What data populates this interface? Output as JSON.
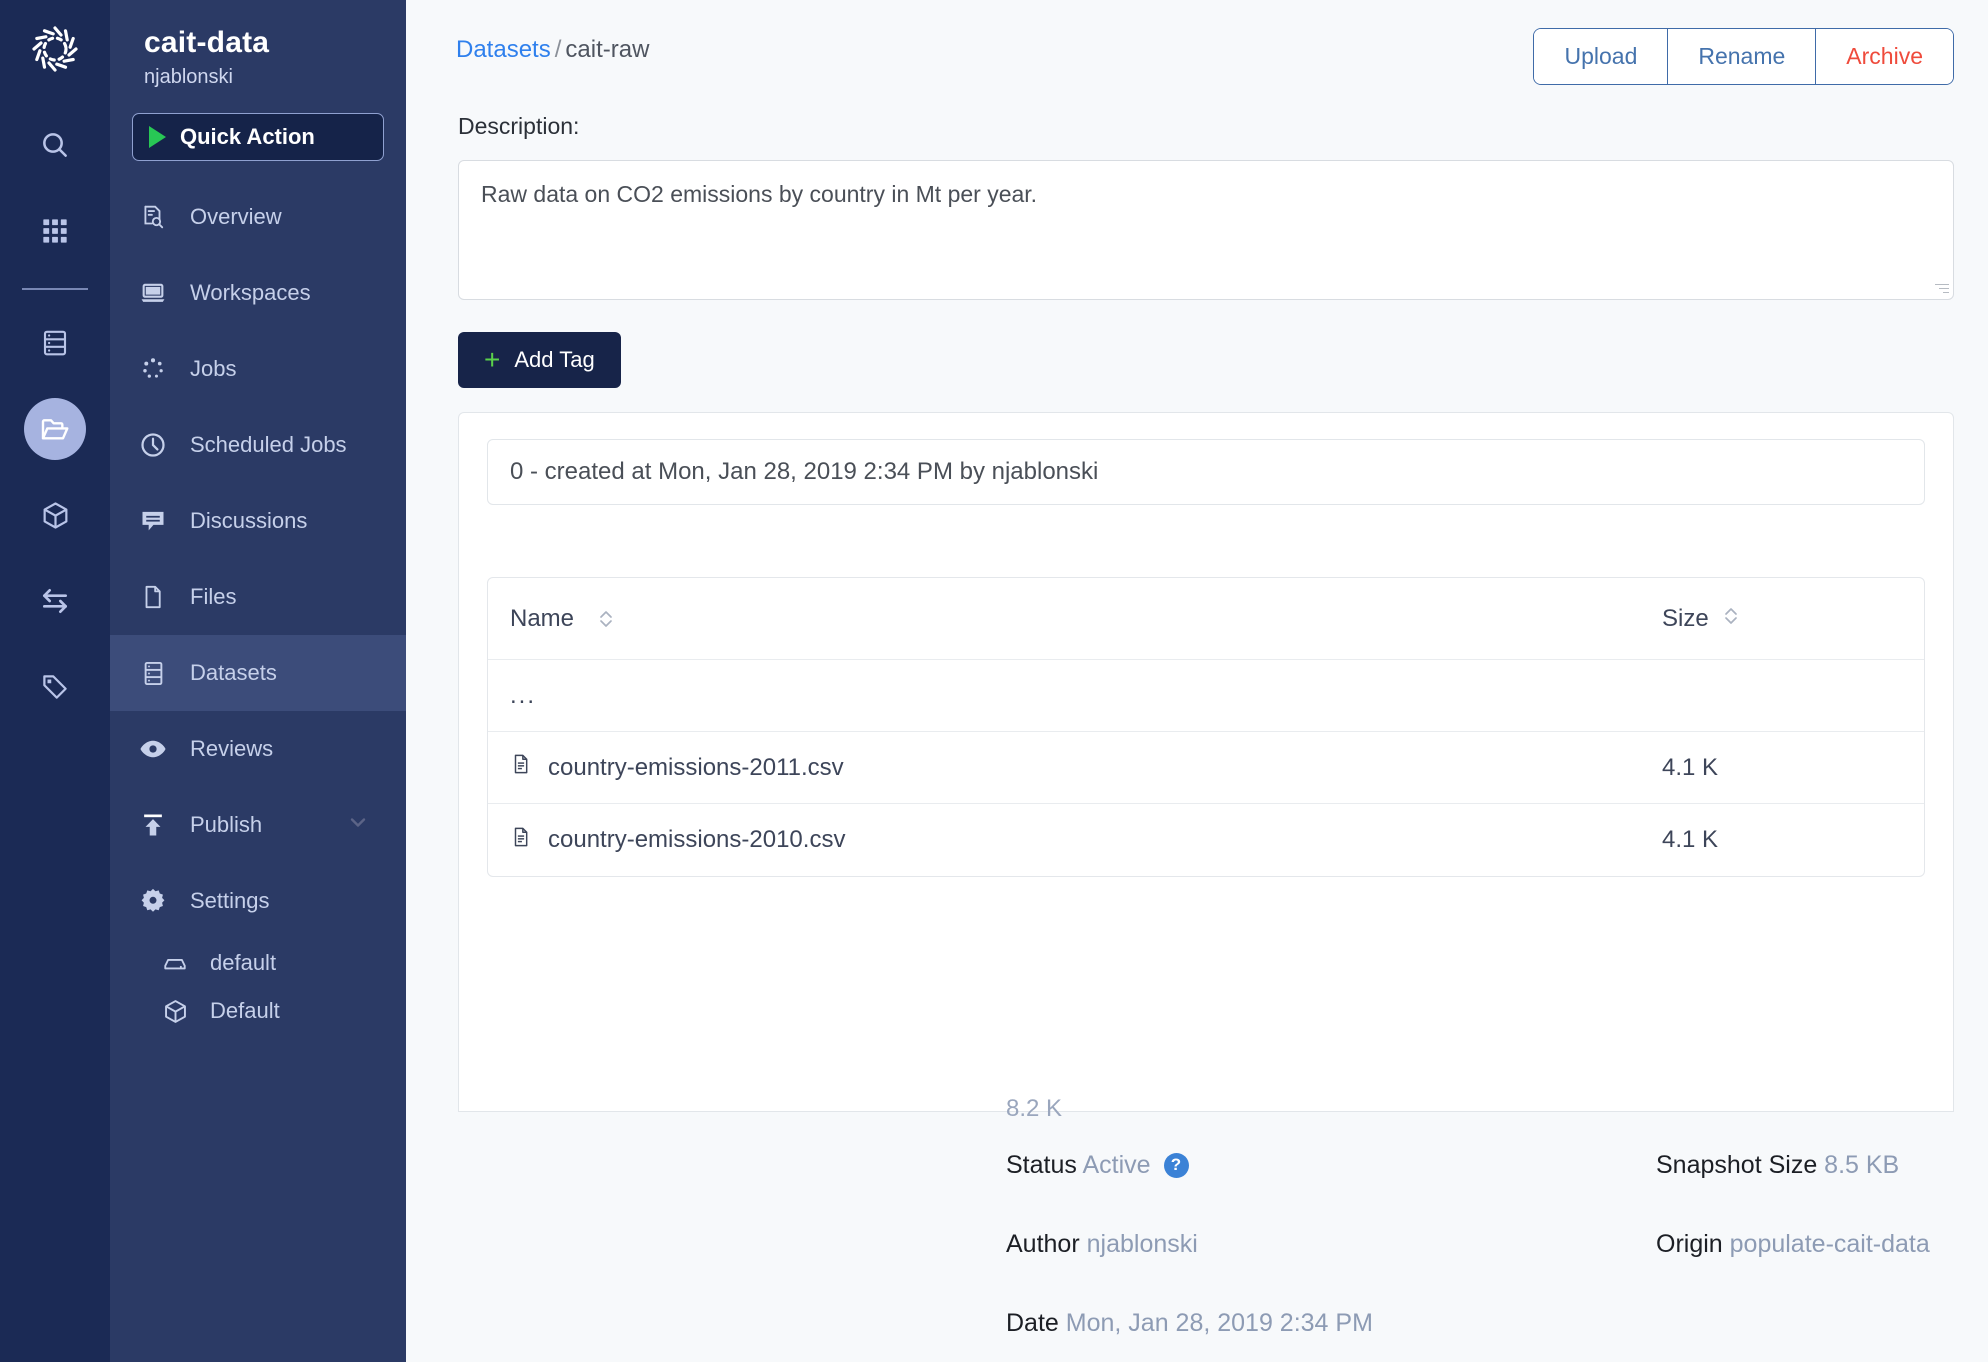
{
  "rail": {
    "logo": "aperture-logo-icon",
    "items": [
      {
        "name": "search-icon",
        "active": false
      },
      {
        "name": "apps-grid-icon",
        "active": false
      },
      {
        "name": "database-icon",
        "active": false
      },
      {
        "name": "folder-open-icon",
        "active": true
      },
      {
        "name": "cube-icon",
        "active": false
      },
      {
        "name": "transfer-arrows-icon",
        "active": false
      },
      {
        "name": "tag-icon",
        "active": false
      }
    ]
  },
  "sidebar": {
    "project_title": "cait-data",
    "owner": "njablonski",
    "quick_action_label": "Quick Action",
    "items": [
      {
        "label": "Overview",
        "icon": "overview-icon",
        "selected": false
      },
      {
        "label": "Workspaces",
        "icon": "laptop-icon",
        "selected": false
      },
      {
        "label": "Jobs",
        "icon": "spinner-icon",
        "selected": false
      },
      {
        "label": "Scheduled Jobs",
        "icon": "clock-icon",
        "selected": false
      },
      {
        "label": "Discussions",
        "icon": "chat-icon",
        "selected": false
      },
      {
        "label": "Files",
        "icon": "file-icon",
        "selected": false
      },
      {
        "label": "Datasets",
        "icon": "datasets-icon",
        "selected": true
      },
      {
        "label": "Reviews",
        "icon": "eye-icon",
        "selected": false
      },
      {
        "label": "Publish",
        "icon": "publish-upload-icon",
        "selected": false,
        "expandable": true
      },
      {
        "label": "Settings",
        "icon": "gear-icon",
        "selected": false
      }
    ],
    "sub_items": [
      {
        "label": "default",
        "icon": "hard-drive-icon"
      },
      {
        "label": "Default",
        "icon": "cube-icon"
      }
    ]
  },
  "header": {
    "breadcrumb_root": "Datasets",
    "breadcrumb_sep": "/",
    "breadcrumb_current": "cait-raw",
    "buttons": [
      {
        "label": "Upload",
        "style": "normal"
      },
      {
        "label": "Rename",
        "style": "normal"
      },
      {
        "label": "Archive",
        "style": "danger"
      }
    ]
  },
  "description": {
    "label": "Description:",
    "value": "Raw data on CO2 emissions by country in Mt per year."
  },
  "tags": {
    "add_label": "Add Tag"
  },
  "snapshot": {
    "version_line": "0 - created at Mon, Jan 28, 2019 2:34 PM by njablonski"
  },
  "file_table": {
    "columns": [
      "Name",
      "Size"
    ],
    "rows": [
      {
        "name": "...",
        "size": "",
        "is_parent": true
      },
      {
        "name": "country-emissions-2011.csv",
        "size": "4.1 K",
        "is_parent": false
      },
      {
        "name": "country-emissions-2010.csv",
        "size": "4.1 K",
        "is_parent": false
      }
    ],
    "total_size": "8.2 K"
  },
  "meta": {
    "status_key": "Status",
    "status_value": "Active",
    "status_help": "?",
    "snapshot_size_key": "Snapshot Size",
    "snapshot_size_value": "8.5 KB",
    "author_key": "Author",
    "author_value": "njablonski",
    "origin_key": "Origin",
    "origin_value": "populate-cait-data",
    "date_key": "Date",
    "date_value": "Mon, Jan 28, 2019 2:34 PM"
  },
  "colors": {
    "rail_bg": "#1b2a55",
    "sidebar_bg": "#2b3a65",
    "selected_nav": "#3c4c7a",
    "accent_blue": "#2f80ed",
    "danger_red": "#ef4b3c",
    "green": "#28c755",
    "main_bg": "#f7f9fb"
  }
}
